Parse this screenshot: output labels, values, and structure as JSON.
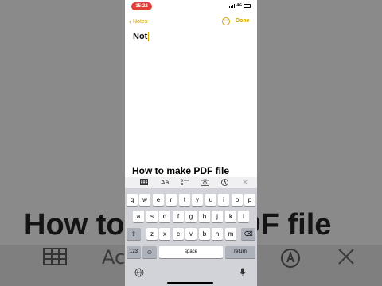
{
  "status_bar": {
    "time": "15:22",
    "network": "4G"
  },
  "nav": {
    "back_label": "Notes",
    "more_label": "···",
    "done_label": "Done"
  },
  "note": {
    "text": "Not"
  },
  "caption": "How to make PDF file",
  "background": {
    "title": "How to make PDF file",
    "glyph_text": "Ac"
  },
  "toolbar": {
    "format_label": "Aa"
  },
  "keyboard": {
    "row1": [
      "q",
      "w",
      "e",
      "r",
      "t",
      "y",
      "u",
      "i",
      "o",
      "p"
    ],
    "row2": [
      "a",
      "s",
      "d",
      "f",
      "g",
      "h",
      "j",
      "k",
      "l"
    ],
    "row3": [
      "z",
      "x",
      "c",
      "v",
      "b",
      "n",
      "m"
    ],
    "shift": "⇧",
    "delete": "⌫",
    "numbers": "123",
    "emoji": "☺",
    "space": "space",
    "return": "return",
    "globe": "🌐",
    "mic": "🎤"
  },
  "colors": {
    "accent": "#d7a400",
    "time_pill": "#e0403a",
    "keyboard_bg": "#d1d3d9"
  }
}
